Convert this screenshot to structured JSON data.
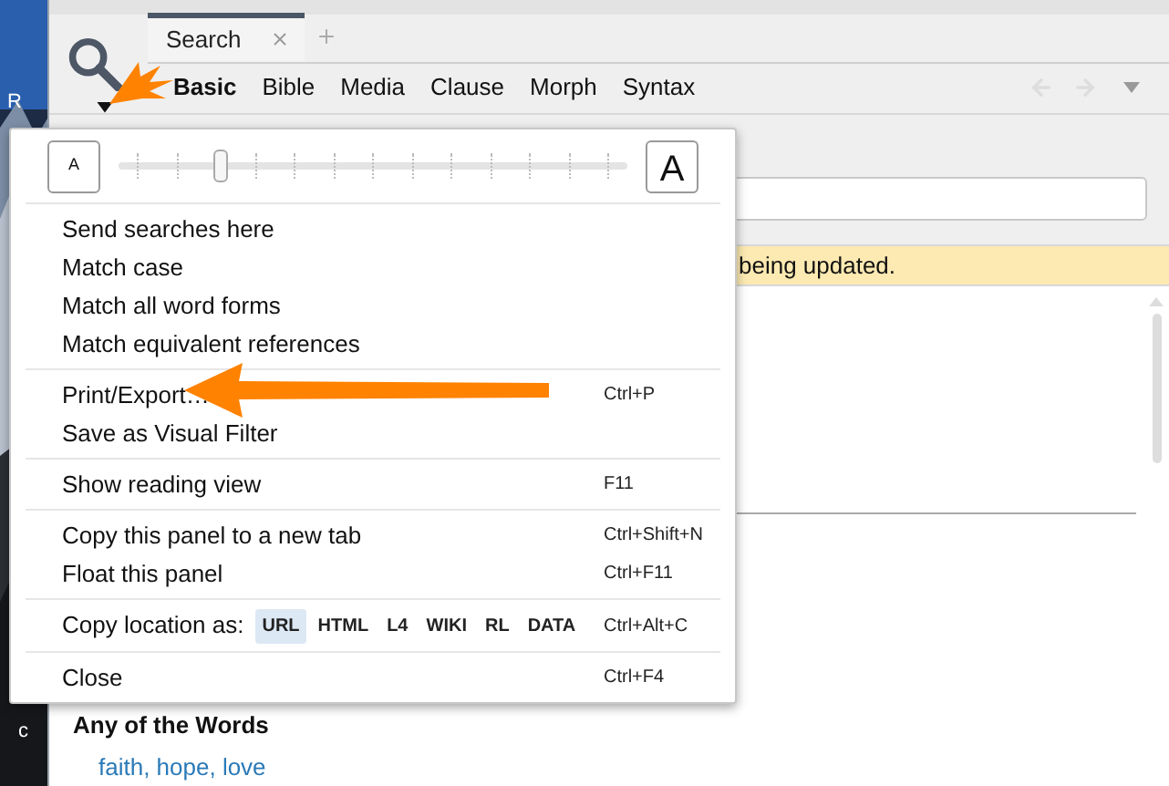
{
  "desktop": {
    "labels": [
      "R",
      "c"
    ]
  },
  "panel": {
    "tabs": [
      {
        "label": "Search",
        "selected": true
      }
    ],
    "search_types": [
      {
        "label": "Basic",
        "selected": true
      },
      {
        "label": "Bible",
        "selected": false
      },
      {
        "label": "Media",
        "selected": false
      },
      {
        "label": "Clause",
        "selected": false
      },
      {
        "label": "Morph",
        "selected": false
      },
      {
        "label": "Syntax",
        "selected": false
      }
    ],
    "banner": "being updated.",
    "results": {
      "heading": "Any of the Words",
      "terms": "faith, hope, love"
    }
  },
  "menu": {
    "zoom": {
      "small": "A",
      "large": "A",
      "level": 0.2
    },
    "groups": [
      [
        {
          "kind": "command",
          "label": "Send searches here"
        },
        {
          "kind": "command",
          "label": "Match case"
        },
        {
          "kind": "command",
          "label": "Match all word forms"
        },
        {
          "kind": "command",
          "label": "Match equivalent references"
        }
      ],
      [
        {
          "kind": "command",
          "label": "Print/Export…",
          "shortcut": "Ctrl+P"
        },
        {
          "kind": "command",
          "label": "Save as Visual Filter"
        }
      ],
      [
        {
          "kind": "command",
          "label": "Show reading view",
          "shortcut": "F11"
        }
      ],
      [
        {
          "kind": "command",
          "label": "Copy this panel to a new tab",
          "shortcut": "Ctrl+Shift+N"
        },
        {
          "kind": "command",
          "label": "Float this panel",
          "shortcut": "Ctrl+F11"
        }
      ],
      [
        {
          "kind": "formats",
          "label": "Copy location as:",
          "shortcut": "Ctrl+Alt+C",
          "formats": [
            {
              "label": "URL",
              "selected": true
            },
            {
              "label": "HTML",
              "selected": false
            },
            {
              "label": "L4",
              "selected": false
            },
            {
              "label": "WIKI",
              "selected": false
            },
            {
              "label": "RL",
              "selected": false
            },
            {
              "label": "DATA",
              "selected": false
            }
          ]
        }
      ],
      [
        {
          "kind": "command",
          "label": "Close",
          "shortcut": "Ctrl+F4"
        }
      ]
    ]
  }
}
